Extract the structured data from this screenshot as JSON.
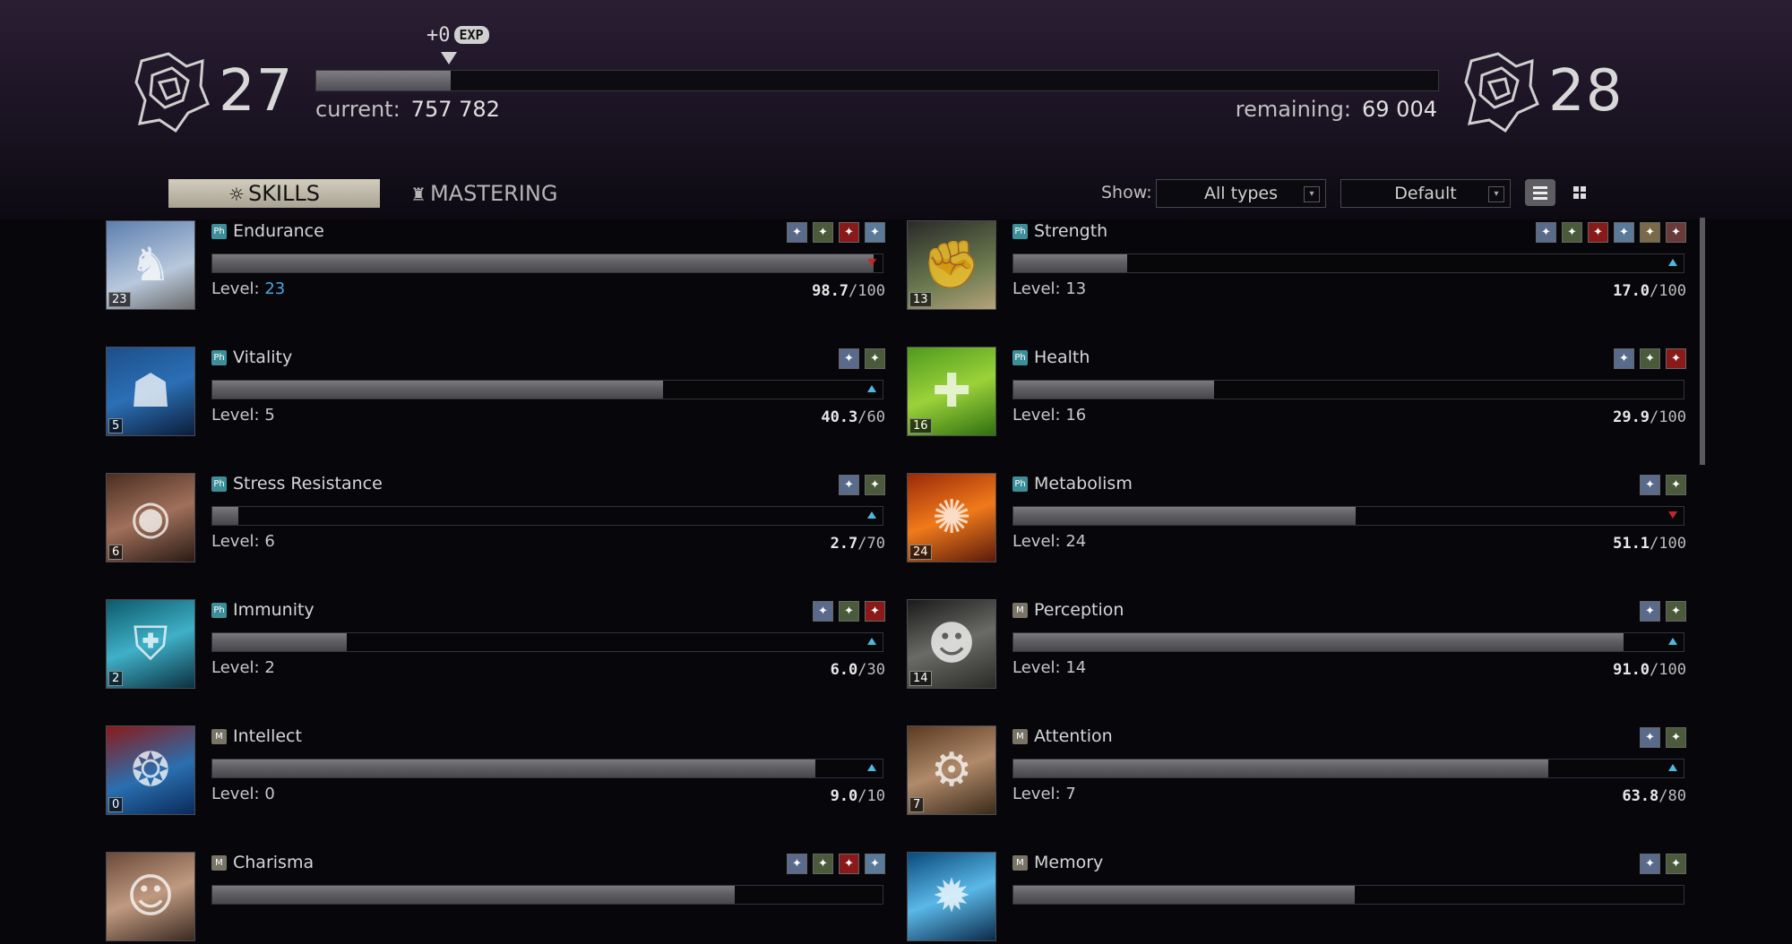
{
  "header": {
    "current_level": "27",
    "next_level": "28",
    "exp_gain": "+0",
    "exp_badge": "EXP",
    "exp_progress_fraction": 0.12,
    "current_label": "current:",
    "current_value": "757 782",
    "remaining_label": "remaining:",
    "remaining_value": "69 004"
  },
  "tabs": {
    "skills": "SKILLS",
    "mastering": "MASTERING"
  },
  "filters": {
    "show_label": "Show:",
    "type_select": "All types",
    "sort_select": "Default"
  },
  "colors": {
    "physical_badge": "#3c8f98",
    "mental_badge": "#7a7467",
    "level_highlight": "#4aa7df",
    "progress_up_arrow": "#4fb8e0",
    "progress_down_arrow": "#c0272d"
  },
  "skills": [
    {
      "name": "Endurance",
      "category": "Ph",
      "level_label": "Level:",
      "level": "23",
      "level_highlight": true,
      "current": "98.7",
      "max": "/100",
      "fill": 0.987,
      "trend": "down",
      "icon": "soldier-icon",
      "perks": [
        "perk-1",
        "perk-2",
        "perk-3",
        "perk-4"
      ]
    },
    {
      "name": "Strength",
      "category": "Ph",
      "level_label": "Level:",
      "level": "13",
      "level_highlight": false,
      "current": "17.0",
      "max": "/100",
      "fill": 0.17,
      "trend": "up",
      "icon": "arm-icon",
      "perks": [
        "perk-1",
        "perk-2",
        "perk-3",
        "perk-4",
        "perk-5",
        "perk-6"
      ]
    },
    {
      "name": "Vitality",
      "category": "Ph",
      "level_label": "Level:",
      "level": "5",
      "level_highlight": false,
      "current": "40.3",
      "max": "/60",
      "fill": 0.672,
      "trend": "up",
      "icon": "silhouette-icon",
      "perks": [
        "perk-1",
        "perk-2"
      ]
    },
    {
      "name": "Health",
      "category": "Ph",
      "level_label": "Level:",
      "level": "16",
      "level_highlight": false,
      "current": "29.9",
      "max": "/100",
      "fill": 0.299,
      "trend": "none",
      "icon": "medical-icon",
      "perks": [
        "perk-1",
        "perk-2",
        "perk-3"
      ]
    },
    {
      "name": "Stress Resistance",
      "category": "Ph",
      "level_label": "Level:",
      "level": "6",
      "level_highlight": false,
      "current": "2.7",
      "max": "/70",
      "fill": 0.039,
      "trend": "up",
      "icon": "eye-icon",
      "perks": [
        "perk-1",
        "perk-2"
      ]
    },
    {
      "name": "Metabolism",
      "category": "Ph",
      "level_label": "Level:",
      "level": "24",
      "level_highlight": false,
      "current": "51.1",
      "max": "/100",
      "fill": 0.511,
      "trend": "down",
      "icon": "fire-icon",
      "perks": [
        "perk-1",
        "perk-2"
      ]
    },
    {
      "name": "Immunity",
      "category": "Ph",
      "level_label": "Level:",
      "level": "2",
      "level_highlight": false,
      "current": "6.0",
      "max": "/30",
      "fill": 0.2,
      "trend": "up",
      "icon": "shield-icon",
      "perks": [
        "perk-1",
        "perk-2",
        "perk-3"
      ]
    },
    {
      "name": "Perception",
      "category": "M",
      "level_label": "Level:",
      "level": "14",
      "level_highlight": false,
      "current": "91.0",
      "max": "/100",
      "fill": 0.91,
      "trend": "up",
      "icon": "face-icon",
      "perks": [
        "perk-1",
        "perk-2"
      ]
    },
    {
      "name": "Intellect",
      "category": "M",
      "level_label": "Level:",
      "level": "0",
      "level_highlight": false,
      "current": "9.0",
      "max": "/10",
      "fill": 0.9,
      "trend": "up",
      "icon": "brain-icon",
      "perks": []
    },
    {
      "name": "Attention",
      "category": "M",
      "level_label": "Level:",
      "level": "7",
      "level_highlight": false,
      "current": "63.8",
      "max": "/80",
      "fill": 0.7975,
      "trend": "up",
      "icon": "tools-icon",
      "perks": [
        "perk-1",
        "perk-2"
      ]
    },
    {
      "name": "Charisma",
      "category": "M",
      "level_label": "",
      "level": "",
      "level_highlight": false,
      "current": "",
      "max": "",
      "fill": 0.78,
      "trend": "none",
      "icon": "beard-face-icon",
      "perks": [
        "perk-1",
        "perk-2",
        "perk-3",
        "perk-4"
      ]
    },
    {
      "name": "Memory",
      "category": "M",
      "level_label": "",
      "level": "",
      "level_highlight": false,
      "current": "",
      "max": "",
      "fill": 0.51,
      "trend": "none",
      "icon": "mind-icon",
      "perks": [
        "perk-1",
        "perk-2"
      ]
    }
  ]
}
